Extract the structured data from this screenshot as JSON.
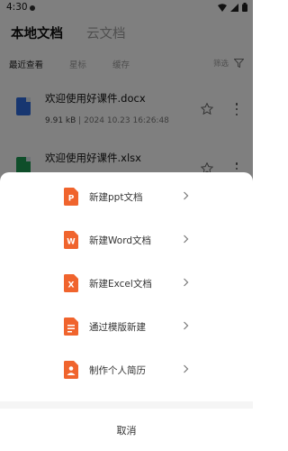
{
  "status_bar": {
    "time": "4:30"
  },
  "header": {
    "tabs": [
      {
        "label": "本地文档",
        "active": true
      },
      {
        "label": "云文档",
        "active": false
      }
    ]
  },
  "sub_tabs": [
    {
      "label": "最近查看",
      "active": true
    },
    {
      "label": "星标",
      "active": false
    },
    {
      "label": "缓存",
      "active": false
    }
  ],
  "filter": {
    "label": "筛选"
  },
  "files": [
    {
      "name": "欢迎使用好课件.docx",
      "size": "9.91 kB",
      "separator": "|",
      "date": "2024 10.23 16:26:48",
      "icon": "word-doc-icon",
      "color": "#2f6de1"
    },
    {
      "name": "欢迎使用好课件.xlsx",
      "size": "",
      "separator": "",
      "date": "",
      "icon": "excel-doc-icon",
      "color": "#1f9d55"
    }
  ],
  "create_sheet": {
    "items": [
      {
        "label": "新建ppt文档",
        "icon": "ppt-icon",
        "letter": "P"
      },
      {
        "label": "新建Word文档",
        "icon": "word-icon",
        "letter": "W"
      },
      {
        "label": "新建Excel文档",
        "icon": "excel-icon",
        "letter": "X"
      },
      {
        "label": "通过模版新建",
        "icon": "template-icon",
        "letter": ""
      },
      {
        "label": "制作个人简历",
        "icon": "resume-icon",
        "letter": ""
      }
    ],
    "cancel_label": "取消"
  },
  "colors": {
    "accent": "#f0642d",
    "scrim": "rgba(0,0,0,0.5)"
  }
}
